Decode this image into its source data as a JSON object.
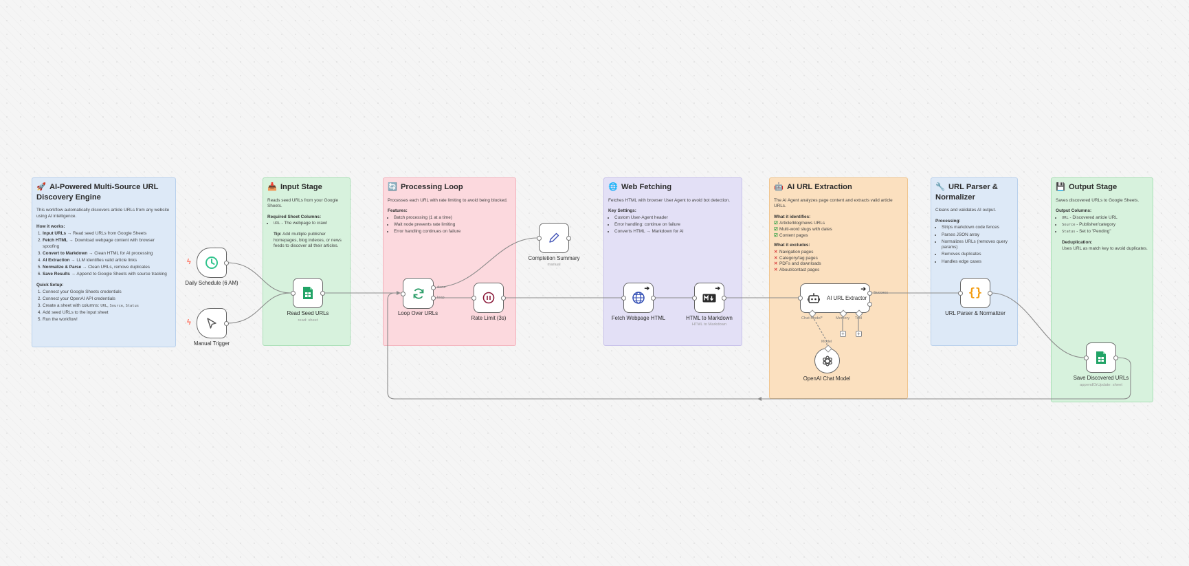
{
  "notes": {
    "main": {
      "emoji": "🚀",
      "title": "AI-Powered Multi-Source URL Discovery Engine",
      "intro": "This workflow automatically discovers article URLs from any website using AI intelligence.",
      "how_title": "How it works:",
      "steps": [
        {
          "bold": "Input URLs",
          "text": "→ Read seed URLs from Google Sheets"
        },
        {
          "bold": "Fetch HTML",
          "text": "→ Download webpage content with browser spoofing"
        },
        {
          "bold": "Convert to Markdown",
          "text": "→ Clean HTML for AI processing"
        },
        {
          "bold": "AI Extraction",
          "text": "→ LLM identifies valid article links"
        },
        {
          "bold": "Normalize & Parse",
          "text": "→ Clean URLs, remove duplicates"
        },
        {
          "bold": "Save Results",
          "text": "→ Append to Google Sheets with source tracking"
        }
      ],
      "setup_title": "Quick Setup:",
      "setup": [
        "Connect your Google Sheets credentials",
        "Connect your OpenAI API credentials",
        "Add seed URLs to the input sheet",
        "Run the workflow!"
      ],
      "setup_cols_prefix": "Create a sheet with columns:",
      "setup_cols": [
        "URL",
        "Source",
        "Status"
      ]
    },
    "input": {
      "emoji": "📥",
      "title": "Input Stage",
      "desc": "Reads seed URLs from your Google Sheets.",
      "req_title": "Required Sheet Columns:",
      "col_code": "URL",
      "col_text": "- The webpage to crawl",
      "tip_bold": "Tip:",
      "tip_text": "Add multiple publisher homepages, blog indexes, or news feeds to discover all their articles."
    },
    "loop": {
      "emoji": "🔄",
      "title": "Processing Loop",
      "desc": "Processes each URL with rate limiting to avoid being blocked.",
      "features_title": "Features:",
      "features": [
        "Batch processing (1 at a time)",
        "Wait node prevents rate limiting",
        "Error handling continues on failure"
      ]
    },
    "fetch": {
      "emoji": "🌐",
      "title": "Web Fetching",
      "desc": "Fetches HTML with browser User Agent to avoid bot detection.",
      "settings_title": "Key Settings:",
      "settings": [
        "Custom User-Agent header",
        "Error handling: continue on failure",
        "Converts HTML → Markdown for AI"
      ]
    },
    "ai": {
      "emoji": "🤖",
      "title": "AI URL Extraction",
      "desc": "The AI Agent analyzes page content and extracts valid article URLs.",
      "ident_title": "What it identifies:",
      "ident": [
        "Article/blog/news URLs",
        "Multi-word slugs with dates",
        "Content pages"
      ],
      "excl_title": "What it excludes:",
      "excl": [
        "Navigation pages",
        "Category/tag pages",
        "PDFs and downloads",
        "About/contact pages"
      ]
    },
    "parser": {
      "emoji": "🔧",
      "title": "URL Parser & Normalizer",
      "desc": "Cleans and validates AI output.",
      "proc_title": "Processing:",
      "proc": [
        "Strips markdown code fences",
        "Parses JSON array",
        "Normalizes URLs (removes query params)",
        "Removes duplicates",
        "Handles edge cases"
      ]
    },
    "output": {
      "emoji": "💾",
      "title": "Output Stage",
      "desc": "Saves discovered URLs to Google Sheets.",
      "cols_title": "Output Columns:",
      "cols": [
        {
          "code": "URL",
          "text": "- Discovered article URL"
        },
        {
          "code": "Source",
          "text": "- Publisher/category"
        },
        {
          "code": "Status",
          "text": "- Set to \"Pending\""
        }
      ],
      "dedup_bold": "Deduplication:",
      "dedup_text": "Uses URL as match key to avoid duplicates."
    }
  },
  "nodes": {
    "daily": {
      "label": "Daily Schedule (6 AM)",
      "icon": "clock-icon"
    },
    "manual": {
      "label": "Manual Trigger",
      "icon": "cursor-icon"
    },
    "read": {
      "label": "Read Seed URLs",
      "sub": "read: sheet",
      "icon": "google-sheets-icon"
    },
    "loop": {
      "label": "Loop Over URLs",
      "icon": "refresh-icon",
      "out_done": "done",
      "out_loop": "loop"
    },
    "rate": {
      "label": "Rate Limit (3s)",
      "icon": "pause-icon"
    },
    "completion": {
      "label": "Completion Summary",
      "sub": "manual",
      "icon": "pencil-icon"
    },
    "fetch": {
      "label": "Fetch Webpage HTML",
      "icon": "globe-icon"
    },
    "markdown": {
      "label": "HTML to Markdown",
      "sub": "HTML to Markdown",
      "icon": "markdown-icon"
    },
    "agent": {
      "label": "AI URL Extractor",
      "icon": "robot-icon",
      "out": "Success",
      "in_chat": "Chat Model*",
      "in_memory": "Memory",
      "in_tool": "Tool"
    },
    "openai": {
      "label": "OpenAI Chat Model",
      "icon": "openai-icon",
      "out": "Model"
    },
    "parser": {
      "label": "URL Parser & Normalizer",
      "icon": "code-braces-icon"
    },
    "save": {
      "label": "Save Discovered URLs",
      "sub": "appendOrUpdate: sheet",
      "icon": "google-sheets-icon"
    }
  },
  "colors": {
    "note_blue": "#dde9f7",
    "note_green": "#d7f2dd",
    "note_red": "#fcd9de",
    "note_purple": "#e3e0f6",
    "note_orange": "#fbe0bf",
    "trigger_bolt": "#ff6d5a",
    "sheets_green": "#21a366",
    "wire": "#8a8a8a"
  }
}
